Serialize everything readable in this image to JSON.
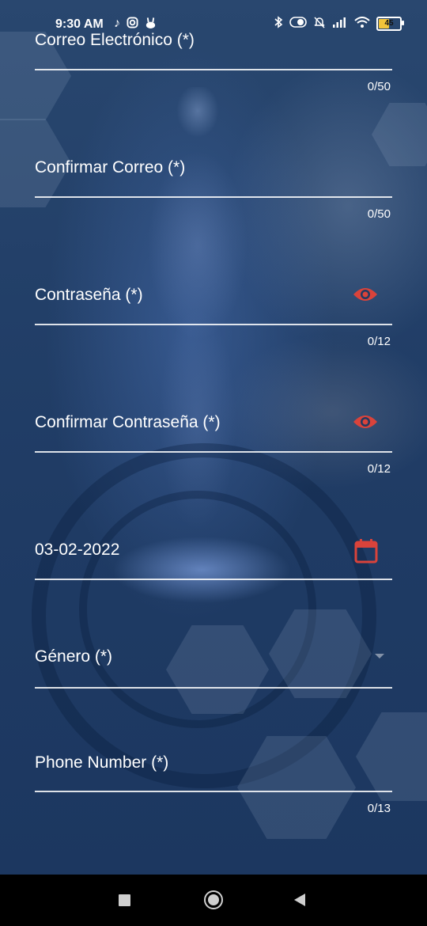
{
  "status_bar": {
    "time": "9:30 AM",
    "app_icons": [
      "tiktok-icon",
      "instagram-icon",
      "bunny-app-icon"
    ],
    "right_icons": [
      "bluetooth-icon",
      "toggle-icon",
      "mute-icon",
      "signal-icon",
      "wifi-icon"
    ],
    "battery_level": "45"
  },
  "colors": {
    "accent_icon": "#d9433b",
    "text": "#ffffff",
    "nav_bar": "#000000"
  },
  "form": {
    "email": {
      "label": "Correo Electrónico (*)",
      "counter": "0/50"
    },
    "confirm_email": {
      "label": "Confirmar Correo (*)",
      "counter": "0/50"
    },
    "password": {
      "label": "Contraseña (*)",
      "counter": "0/12",
      "icon": "eye-icon"
    },
    "confirm_password": {
      "label": "Confirmar Contraseña (*)",
      "counter": "0/12",
      "icon": "eye-icon"
    },
    "birth_date": {
      "value": "03-02-2022",
      "icon": "calendar-icon"
    },
    "gender": {
      "label": "Género (*)",
      "icon": "dropdown-arrow-icon"
    },
    "phone": {
      "label": "Phone Number (*)",
      "counter": "0/13"
    }
  },
  "nav_bar": {
    "icons": [
      "recents-icon",
      "home-icon",
      "back-icon"
    ]
  }
}
